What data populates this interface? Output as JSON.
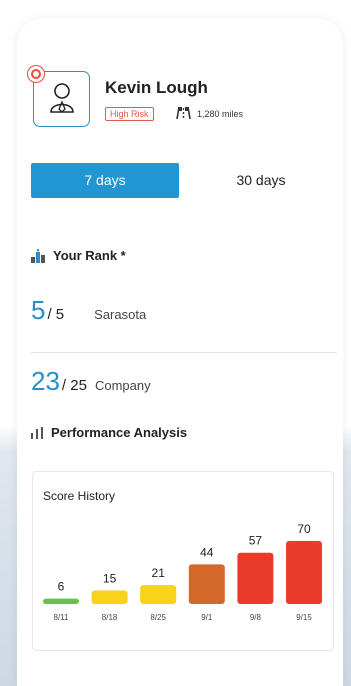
{
  "profile": {
    "name": "Kevin Lough",
    "risk_badge": "High Risk",
    "miles": "1,280 miles",
    "avatar_icon": "user-icon",
    "risk_color": "#e74c3c"
  },
  "tabs": {
    "active": "7 days",
    "inactive": "30 days",
    "accent": "#2196d3"
  },
  "rank": {
    "title": "Your Rank *",
    "local": {
      "value": "5",
      "total": "/ 5",
      "label": "Sarasota"
    },
    "company": {
      "value": "23",
      "total": "/ 25",
      "label": "Company"
    }
  },
  "performance": {
    "title": "Performance Analysis"
  },
  "chart_data": {
    "type": "bar",
    "title": "Score History",
    "categories": [
      "8/11",
      "8/18",
      "8/25",
      "9/1",
      "9/8",
      "9/15"
    ],
    "values": [
      6,
      15,
      21,
      44,
      57,
      70
    ],
    "colors": [
      "#6ac04a",
      "#f8d21b",
      "#f8d21b",
      "#d2692a",
      "#ea3b2a",
      "#ea3b2a"
    ],
    "ylim": [
      0,
      70
    ],
    "grid": false
  }
}
